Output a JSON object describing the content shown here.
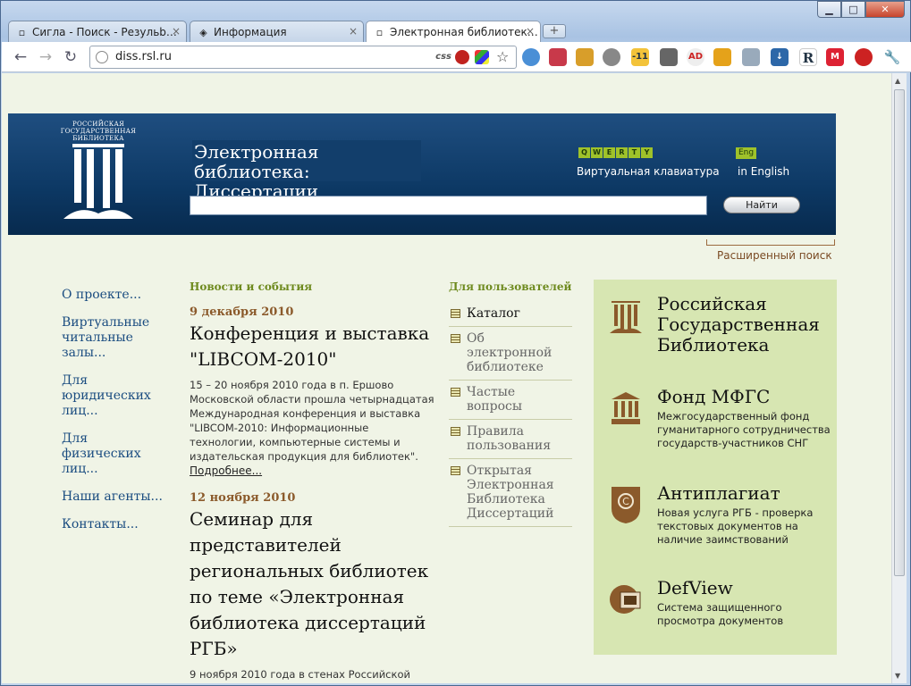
{
  "browser": {
    "tabs": [
      {
        "label": "Сигла - Поиск - Резульb…",
        "active": false
      },
      {
        "label": "Информация",
        "active": false
      },
      {
        "label": "Электронная библиотек…",
        "active": true
      }
    ],
    "url": "diss.rsl.ru",
    "css_label": "css"
  },
  "header": {
    "logo_text": "РОССИЙСКАЯ ГОСУДАРСТВЕННАЯ БИБЛИОТЕКА",
    "title": "Электронная библиотека: Диссертации",
    "qwerty_keys": [
      "Q",
      "W",
      "E",
      "R",
      "T",
      "Y"
    ],
    "virtual_keyboard": "Виртуальная клавиатура",
    "eng_badge": "Eng",
    "in_english": "in English",
    "search_value": "",
    "find_button": "Найти",
    "advanced_search": "Расширенный поиск"
  },
  "leftnav": [
    "О проекте...",
    "Виртуальные читальные залы...",
    "Для юридических лиц...",
    "Для физических лиц...",
    "Наши агенты...",
    "Контакты..."
  ],
  "news": {
    "heading": "Новости и события",
    "items": [
      {
        "date": "9 декабря 2010",
        "title": "Конференция и выставка \"LIBCOM-2010\"",
        "text": "15 – 20 ноября 2010 года в п. Ершово Московской области прошла четырнадцатая Международная конференция и выставка \"LIBCOM-2010: Информационные технологии, компьютерные системы и издательская продукция для библиотек\".",
        "more": "Подробнее..."
      },
      {
        "date": "12 ноября 2010",
        "title": "Семинар для представителей региональных библиотек по теме «Электронная библиотека диссертаций РГБ»",
        "text": "9 ноября 2010 года в стенах Российской"
      }
    ]
  },
  "users": {
    "heading": "Для пользователей",
    "items": [
      "Каталог",
      "Об электронной библиотеке",
      "Частые вопросы",
      "Правила пользования",
      "Открытая Электронная Библиотека Диссертаций"
    ]
  },
  "partners": [
    {
      "title": "Российская Государственная Библиотека",
      "desc": "",
      "icon": "rsl-logo-icon"
    },
    {
      "title": "Фонд МФГС",
      "desc": "Межгосударственный фонд гуманитарного сотрудничества государств-участников СНГ",
      "icon": "mfgs-icon"
    },
    {
      "title": "Антиплагиат",
      "desc": "Новая услуга РГБ - проверка текстовых документов на наличие заимствований",
      "icon": "antiplagiat-icon"
    },
    {
      "title": "DefView",
      "desc": "Система защищенного просмотра документов",
      "icon": "defview-icon"
    }
  ]
}
